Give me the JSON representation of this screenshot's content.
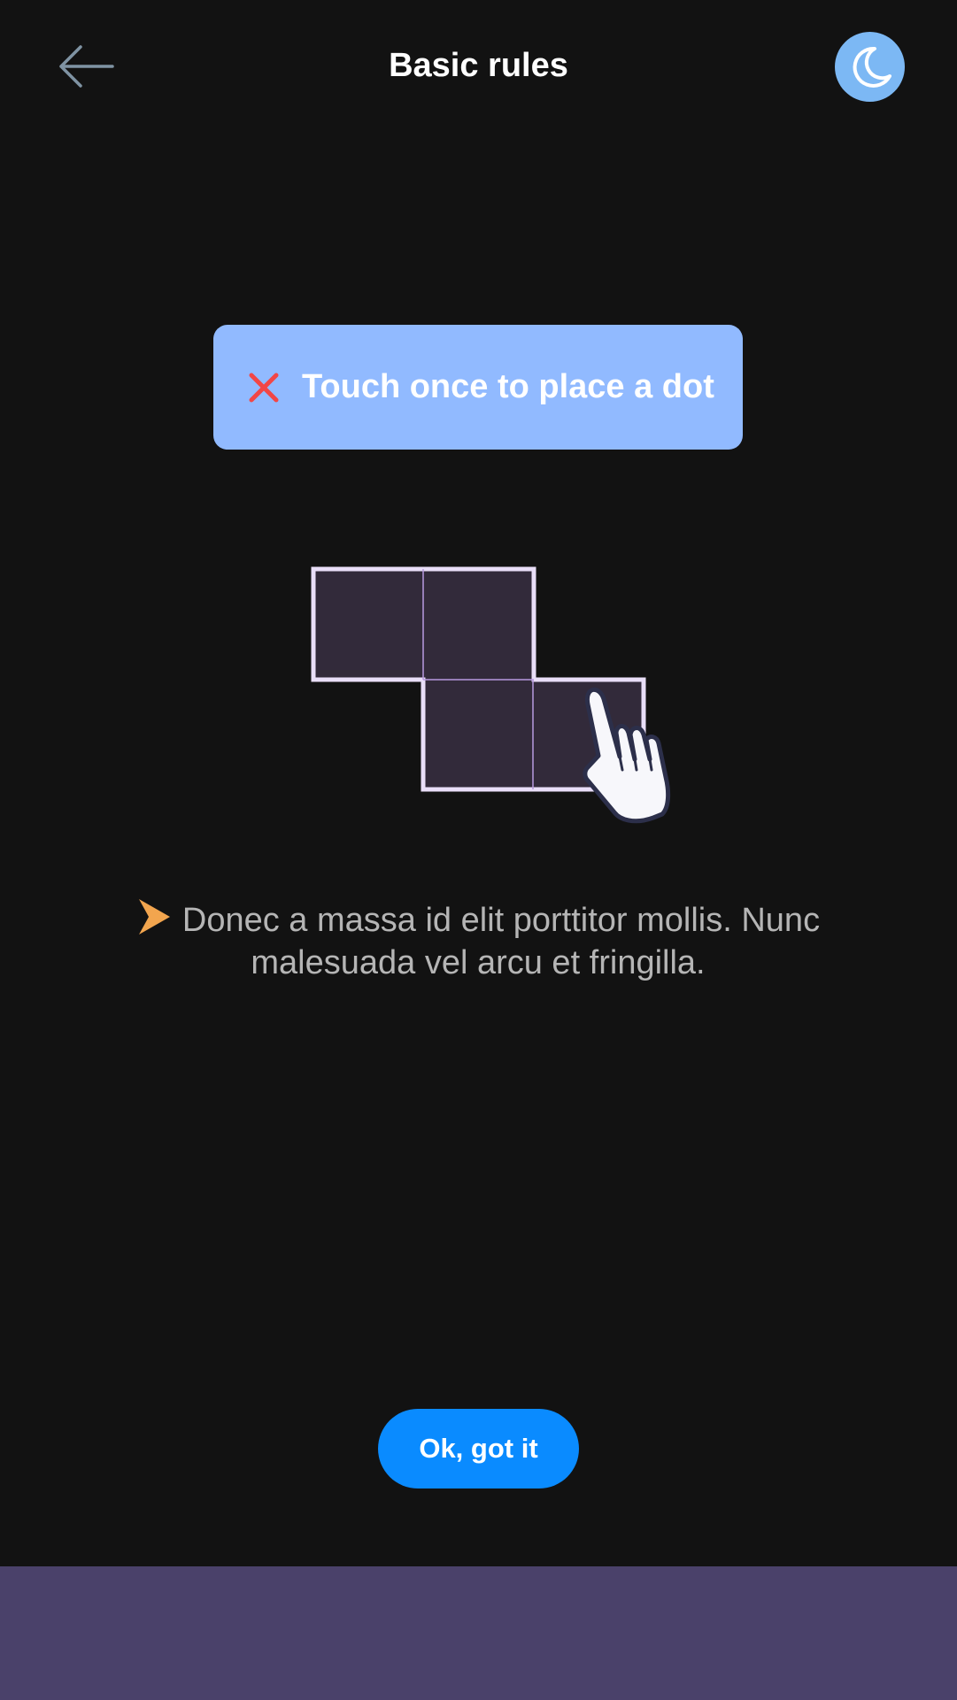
{
  "header": {
    "title": "Basic rules",
    "back_icon": "arrow-left-icon",
    "theme_icon": "moon-icon"
  },
  "toast": {
    "icon": "close-x-icon",
    "text": "Touch once to place a dot"
  },
  "hint": {
    "icon": "arrow-right-icon",
    "text": "Donec a massa id elit porttitor mollis. Nunc malesuada vel arcu et fringilla."
  },
  "actions": {
    "ok_label": "Ok, got it"
  },
  "colors": {
    "background": "#121212",
    "toast": "#91baff",
    "toast_icon": "#f24646",
    "theme_toggle": "#7cb8f4",
    "primary_button": "#0a8bff",
    "cell_fill": "#322a3a",
    "cell_border": "#e9def8",
    "hint_arrow": "#f2a54e",
    "bottom_bar": "#4a416a"
  }
}
